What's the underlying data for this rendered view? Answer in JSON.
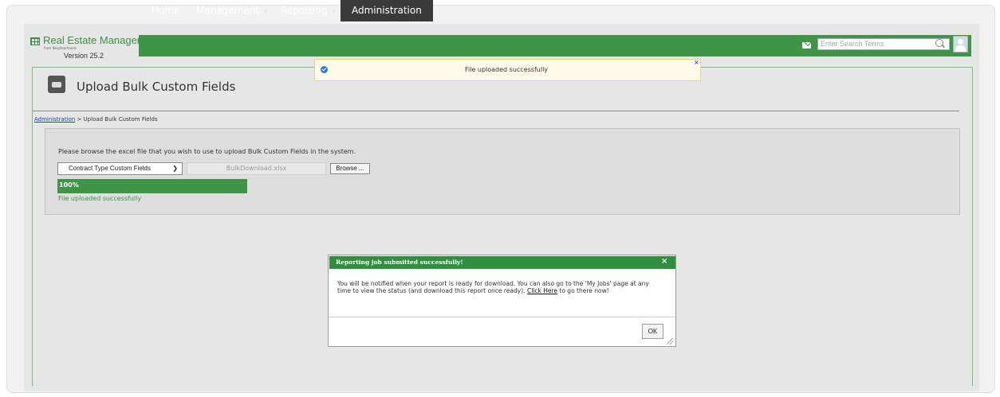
{
  "app": {
    "logo_title": "Real Estate Manager",
    "logo_tagline": "from Neighborhoods",
    "version": "Version 25.2"
  },
  "nav": {
    "items": [
      {
        "label": "Home"
      },
      {
        "label": "Management",
        "caret": "▾"
      },
      {
        "label": "Reporting",
        "caret": "▾"
      },
      {
        "label": "Administration"
      }
    ],
    "active": "Administration"
  },
  "header": {
    "search_placeholder": "Enter Search Terms"
  },
  "toast": {
    "message": "File uploaded successfully",
    "close": "×"
  },
  "page": {
    "title": "Upload Bulk Custom Fields",
    "breadcrumb_link": "Administration",
    "breadcrumb_rest": "> Upload Bulk Custom Fields"
  },
  "upload": {
    "instruction": "Please browse the excel file that you wish to use to upload Bulk Custom Fields in the system.",
    "select_value": "Contract Type Custom Fields",
    "file_name": "BulkDownload.xlsx",
    "browse_label": "Browse ...",
    "progress_text": "100%",
    "progress_value": 1.0,
    "status": "File uploaded successfully"
  },
  "modal": {
    "title": "Reporting job submitted successfully!",
    "close": "×",
    "body_before": "You will be notified when your report is ready for download. You can also go to the 'My Jobs' page at any time to view the status (and download this report once ready).",
    "link": "Click Here",
    "body_after": "to go there now!",
    "ok_label": "OK"
  },
  "colors": {
    "brand_green": "#3f9448",
    "active_nav": "#3a3a3a",
    "toast_bg": "#fffbea",
    "link_blue": "#1a3fb8"
  }
}
